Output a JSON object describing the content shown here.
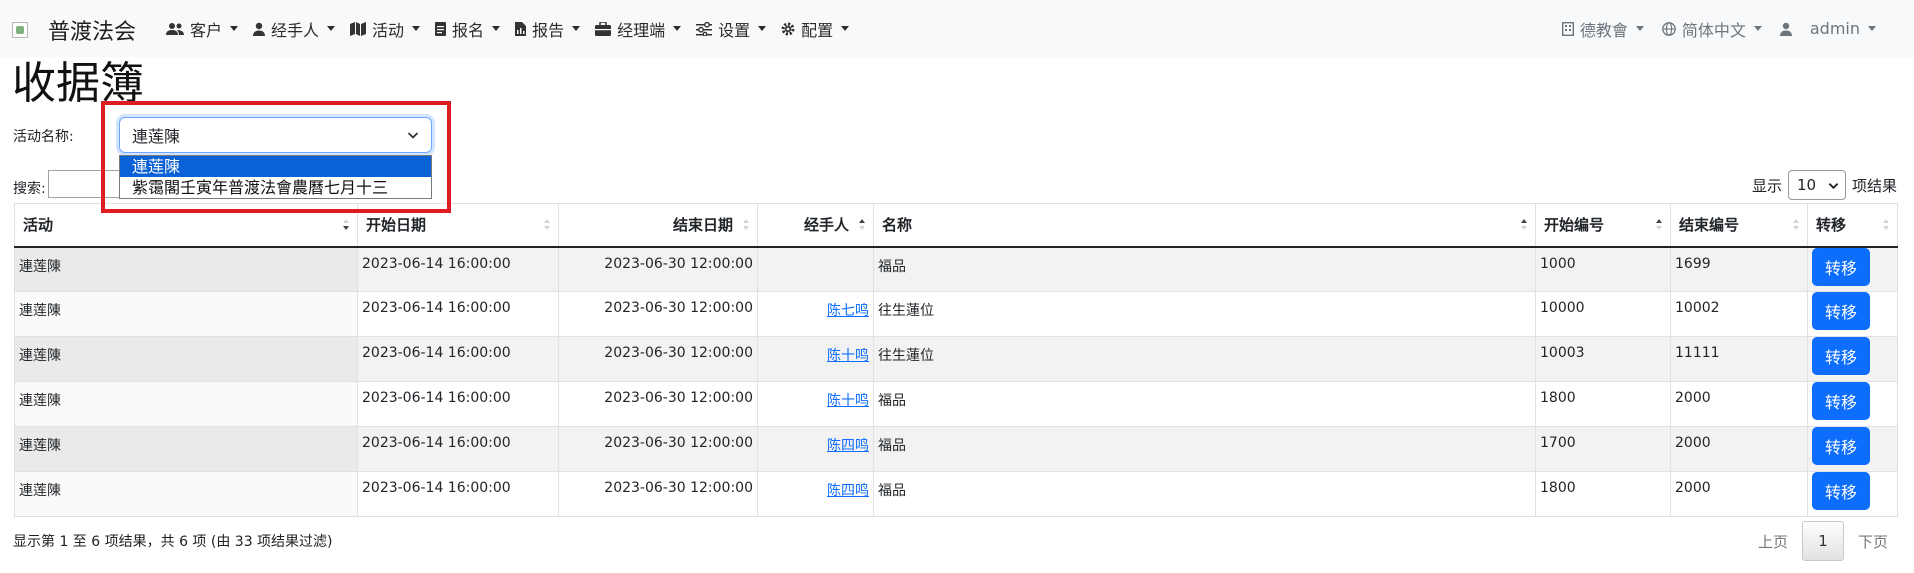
{
  "navbar": {
    "brand": "普渡法会",
    "left_items": [
      {
        "label": "客户",
        "icon": "users-icon"
      },
      {
        "label": "经手人",
        "icon": "user-icon"
      },
      {
        "label": "活动",
        "icon": "map-icon"
      },
      {
        "label": "报名",
        "icon": "document-icon"
      },
      {
        "label": "报告",
        "icon": "file-chart-icon"
      },
      {
        "label": "经理端",
        "icon": "briefcase-icon"
      },
      {
        "label": "设置",
        "icon": "sliders-icon"
      },
      {
        "label": "配置",
        "icon": "gear-icon"
      }
    ],
    "right_items": [
      {
        "label": "德教會",
        "icon": "building-icon"
      },
      {
        "label": "简体中文",
        "icon": "globe-icon"
      },
      {
        "label": "admin",
        "icon": "user-icon"
      }
    ]
  },
  "page": {
    "title": "收据簿"
  },
  "filter": {
    "label": "活动名称:",
    "selected": "連莲陳",
    "options": [
      "連莲陳",
      "紫霭閣壬寅年普渡法會農曆七月十三"
    ]
  },
  "search": {
    "label": "搜索:",
    "value": ""
  },
  "length": {
    "prefix": "显示",
    "value": "10",
    "suffix": "项结果"
  },
  "table": {
    "columns": [
      "活动",
      "开始日期",
      "结束日期",
      "经手人",
      "名称",
      "开始编号",
      "结束编号",
      "转移"
    ],
    "rows": [
      {
        "activity": "連莲陳",
        "start": "2023-06-14 16:00:00",
        "end": "2023-06-30 12:00:00",
        "handler": "",
        "name": "福品",
        "start_no": "1000",
        "end_no": "1699",
        "action": "转移"
      },
      {
        "activity": "連莲陳",
        "start": "2023-06-14 16:00:00",
        "end": "2023-06-30 12:00:00",
        "handler": "陈七鸣",
        "name": "往生蓮位",
        "start_no": "10000",
        "end_no": "10002",
        "action": "转移"
      },
      {
        "activity": "連莲陳",
        "start": "2023-06-14 16:00:00",
        "end": "2023-06-30 12:00:00",
        "handler": "陈十鸣",
        "name": "往生蓮位",
        "start_no": "10003",
        "end_no": "11111",
        "action": "转移"
      },
      {
        "activity": "連莲陳",
        "start": "2023-06-14 16:00:00",
        "end": "2023-06-30 12:00:00",
        "handler": "陈十鸣",
        "name": "福品",
        "start_no": "1800",
        "end_no": "2000",
        "action": "转移"
      },
      {
        "activity": "連莲陳",
        "start": "2023-06-14 16:00:00",
        "end": "2023-06-30 12:00:00",
        "handler": "陈四鸣",
        "name": "福品",
        "start_no": "1700",
        "end_no": "2000",
        "action": "转移"
      },
      {
        "activity": "連莲陳",
        "start": "2023-06-14 16:00:00",
        "end": "2023-06-30 12:00:00",
        "handler": "陈四鸣",
        "name": "福品",
        "start_no": "1800",
        "end_no": "2000",
        "action": "转移"
      }
    ]
  },
  "footer": {
    "info": "显示第 1 至 6 项结果，共 6 项 (由 33 项结果过滤)",
    "prev": "上页",
    "current": "1",
    "next": "下页"
  },
  "colors": {
    "accent": "#0d6efd",
    "highlight": "#e11b22",
    "selected_option": "#0a62d6"
  }
}
